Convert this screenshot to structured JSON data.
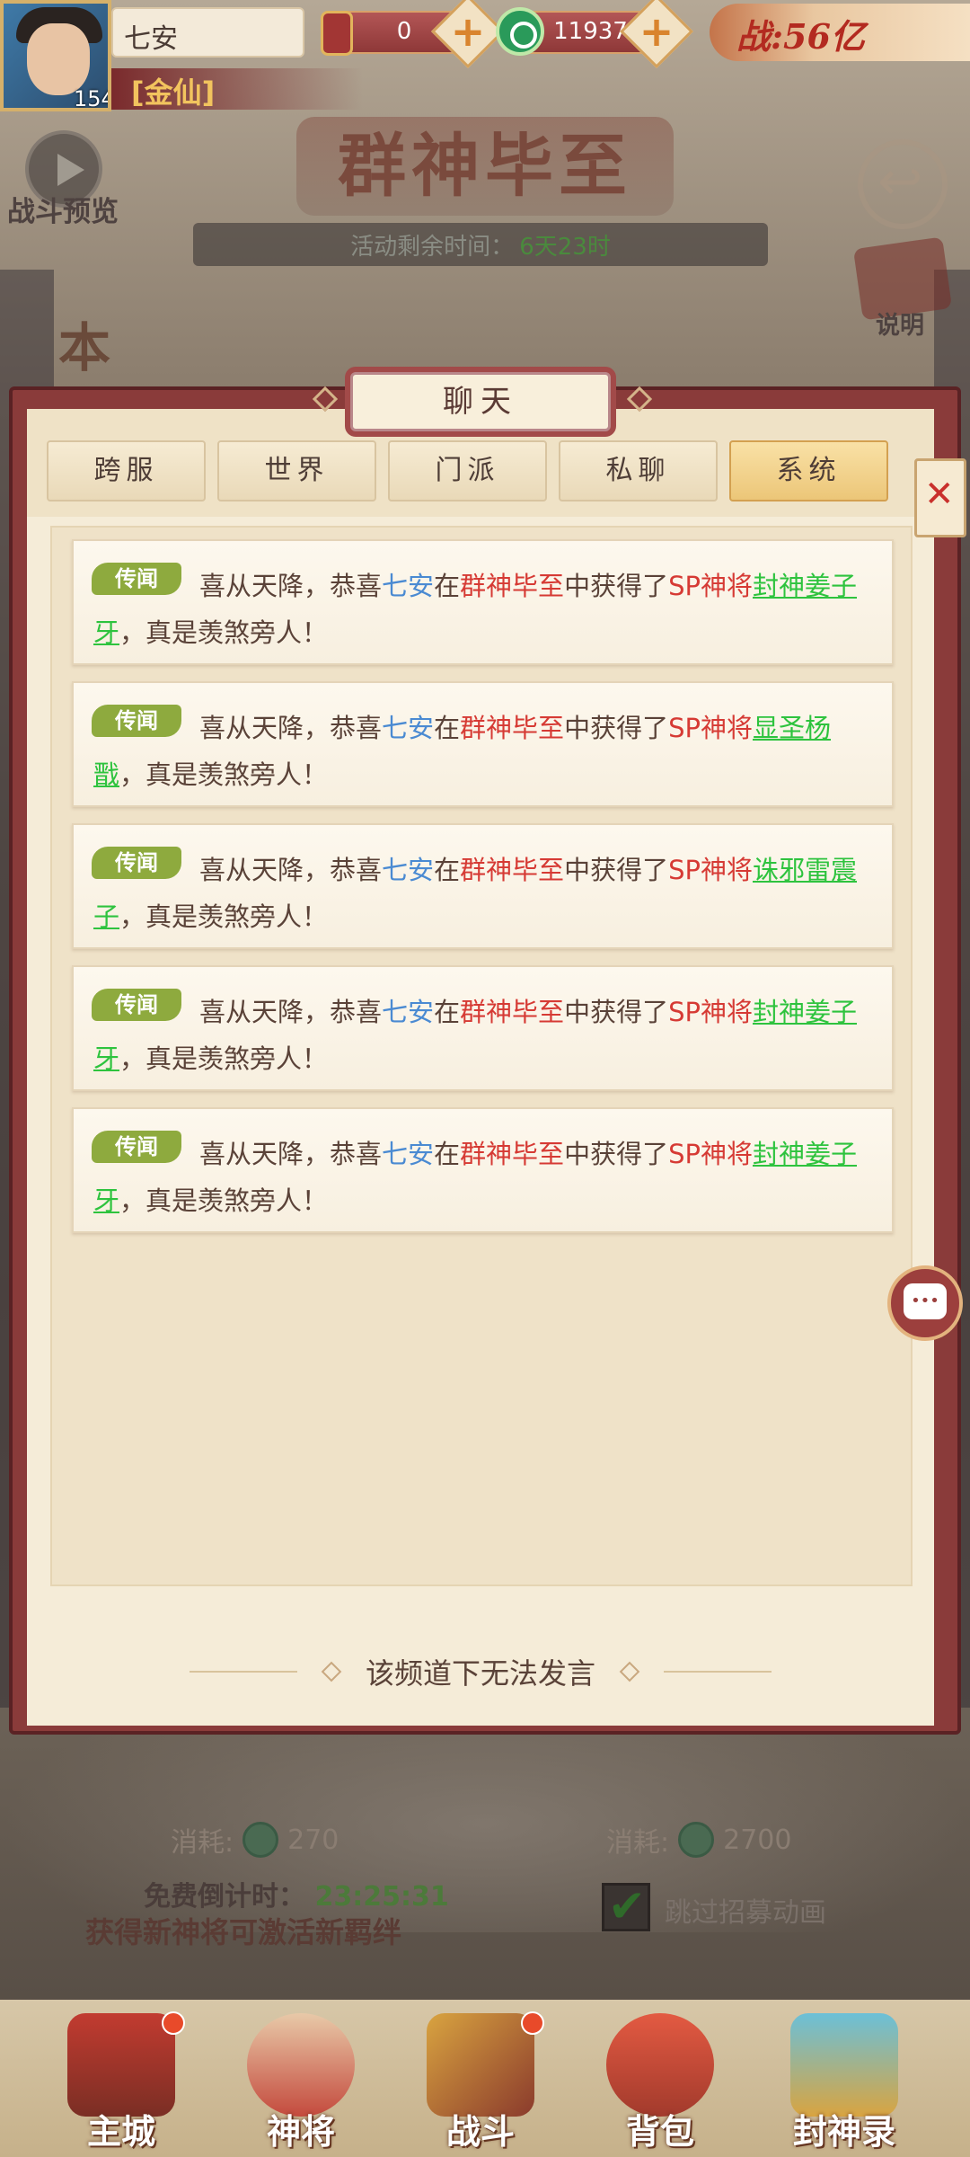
{
  "player": {
    "name": "七安",
    "level": "154",
    "rank": "[金仙]"
  },
  "resources": {
    "tokens": "0",
    "jade": "11937",
    "power": "战:56亿"
  },
  "background": {
    "event_title": "群神毕至",
    "remaining_label": "活动剩余时间：",
    "remaining_value": "6天23时",
    "battle_preview": "战斗预览",
    "explain": "说明",
    "side_char": "本",
    "cost_label": "消耗:",
    "cost_left": "270",
    "cost_right": "2700",
    "free_countdown_label": "免费倒计时：",
    "free_countdown_value": "23:25:31",
    "tip": "获得新神将可激活新羁绊",
    "skip_animation": "跳过招募动画"
  },
  "chat": {
    "title": "聊天",
    "tabs": [
      {
        "label": "跨服"
      },
      {
        "label": "世界"
      },
      {
        "label": "门派"
      },
      {
        "label": "私聊"
      },
      {
        "label": "系统"
      }
    ],
    "active_tab": "系统",
    "footer_notice": "该频道下无法发言",
    "messages": [
      {
        "tag": "传闻",
        "p1": "喜从天降，恭喜",
        "player": "七安",
        "p2": "在",
        "event": "群神毕至",
        "p3": "中获得了",
        "grade": "SP神将",
        "hero": "封神姜子牙",
        "p4": "，真是羡煞旁人！"
      },
      {
        "tag": "传闻",
        "p1": "喜从天降，恭喜",
        "player": "七安",
        "p2": "在",
        "event": "群神毕至",
        "p3": "中获得了",
        "grade": "SP神将",
        "hero": "显圣杨戬",
        "p4": "，真是羡煞旁人！"
      },
      {
        "tag": "传闻",
        "p1": "喜从天降，恭喜",
        "player": "七安",
        "p2": "在",
        "event": "群神毕至",
        "p3": "中获得了",
        "grade": "SP神将",
        "hero": "诛邪雷震子",
        "p4": "，真是羡煞旁人！"
      },
      {
        "tag": "传闻",
        "p1": "喜从天降，恭喜",
        "player": "七安",
        "p2": "在",
        "event": "群神毕至",
        "p3": "中获得了",
        "grade": "SP神将",
        "hero": "封神姜子牙",
        "p4": "，真是羡煞旁人！"
      },
      {
        "tag": "传闻",
        "p1": "喜从天降，恭喜",
        "player": "七安",
        "p2": "在",
        "event": "群神毕至",
        "p3": "中获得了",
        "grade": "SP神将",
        "hero": "封神姜子牙",
        "p4": "，真是羡煞旁人！"
      }
    ]
  },
  "nav": [
    {
      "label": "主城"
    },
    {
      "label": "神将"
    },
    {
      "label": "战斗"
    },
    {
      "label": "背包"
    },
    {
      "label": "封神录"
    }
  ],
  "colors": {
    "accent_red": "#d63a34",
    "player_blue": "#4a8ad2",
    "hero_green": "#2ec33e",
    "tag_green": "#8eaa3e",
    "active_tab_gold": "#ecc678"
  },
  "icons": [
    "play-icon",
    "back-arrow-icon",
    "scroll-icon",
    "token-icon",
    "jade-coin-icon",
    "plus-icon",
    "close-icon",
    "chat-bubble-icon",
    "checkbox-icon"
  ]
}
